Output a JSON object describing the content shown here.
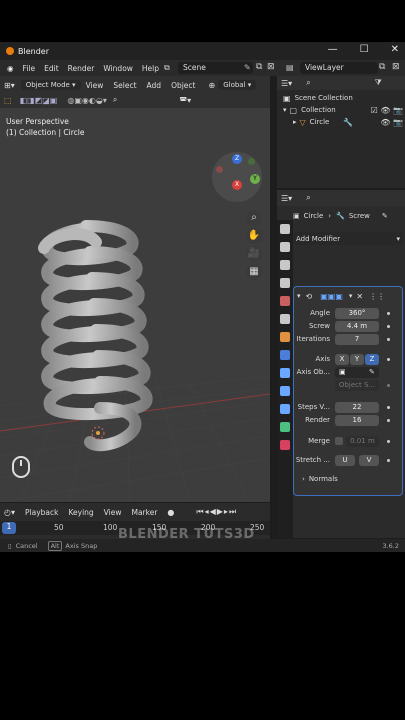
{
  "app": {
    "title": "Blender",
    "version": "3.6.2"
  },
  "window_controls": {
    "minimize": "—",
    "maximize": "☐",
    "close": "✕"
  },
  "menu": [
    "File",
    "Edit",
    "Render",
    "Window",
    "Help"
  ],
  "scene": "Scene",
  "view_layer": "ViewLayer",
  "viewport": {
    "mode": "Object Mode",
    "menu": [
      "View",
      "Select",
      "Add",
      "Object"
    ],
    "orientation": "Global",
    "overlay_line1": "User Perspective",
    "overlay_line2": "(1) Collection | Circle",
    "gizmo_axes": {
      "z": "Z",
      "y": "Y",
      "x": "X"
    }
  },
  "outliner": {
    "rows": [
      "Scene Collection",
      "Collection",
      "Circle"
    ]
  },
  "properties": {
    "breadcrumb_object": "Circle",
    "breadcrumb_modifier": "Screw",
    "add_modifier": "Add Modifier",
    "fields": {
      "angle_label": "Angle",
      "angle_value": "360°",
      "screw_label": "Screw",
      "screw_value": "4.4 m",
      "iterations_label": "Iterations",
      "iterations_value": "7",
      "axis_label": "Axis",
      "axis_x": "X",
      "axis_y": "Y",
      "axis_z": "Z",
      "axis_object_label": "Axis Ob...",
      "object_screw_label": "Object S...",
      "steps_viewport_label": "Steps V...",
      "steps_viewport_value": "22",
      "render_label": "Render",
      "render_value": "16",
      "merge_label": "Merge",
      "merge_value": "0.01 m",
      "stretch_label": "Stretch ...",
      "stretch_u": "U",
      "stretch_v": "V",
      "normals_label": "Normals"
    }
  },
  "timeline": {
    "menu": [
      "Playback",
      "Keying",
      "View",
      "Marker"
    ],
    "current_frame": "1",
    "ticks": [
      "50",
      "100",
      "150",
      "200",
      "250"
    ]
  },
  "status": {
    "cancel": "Cancel",
    "alt": "Alt",
    "axis_snap": "Axis Snap"
  },
  "watermark": "BLENDER TUTS3D",
  "colors": {
    "accent": "#3f6bb5",
    "modifier_outline": "#3e6fc0",
    "logo": "#e87d0d"
  }
}
